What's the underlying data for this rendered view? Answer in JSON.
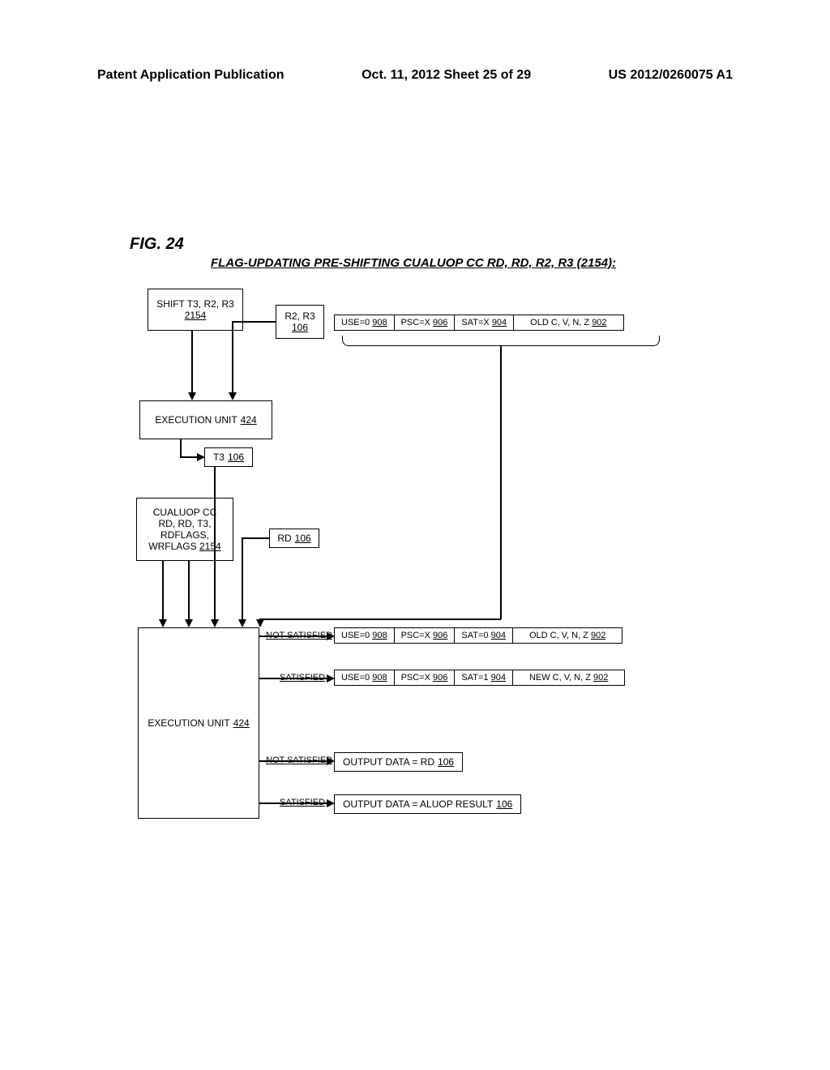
{
  "header": {
    "left": "Patent Application Publication",
    "center": "Oct. 11, 2012  Sheet 25 of 29",
    "right": "US 2012/0260075 A1"
  },
  "figure": {
    "label": "FIG. 24",
    "title": "FLAG-UPDATING PRE-SHIFTING CUALUOP CC RD, RD, R2, R3 (2154):"
  },
  "blocks": {
    "shift": {
      "line1": "SHIFT T3, R2, R3",
      "ref": "2154"
    },
    "r2r3": {
      "label": "R2, R3",
      "ref": "106"
    },
    "row1": {
      "use": "USE=0",
      "use_ref": "908",
      "psc": "PSC=X",
      "psc_ref": "906",
      "sat": "SAT=X",
      "sat_ref": "904",
      "flags": "OLD C, V, N, Z",
      "flags_ref": "902"
    },
    "execunit1": {
      "label": "EXECUTION UNIT",
      "ref": "424"
    },
    "t3": {
      "label": "T3",
      "ref": "106"
    },
    "cualuop": {
      "l1": "CUALUOP CC",
      "l2": "RD, RD, T3,",
      "l3": "RDFLAGS,",
      "l4": "WRFLAGS",
      "ref": "2154"
    },
    "rd": {
      "label": "RD",
      "ref": "106"
    },
    "execunit2": {
      "label": "EXECUTION UNIT",
      "ref": "424"
    },
    "row_notsat": {
      "use": "USE=0",
      "use_ref": "908",
      "psc": "PSC=X",
      "psc_ref": "906",
      "sat": "SAT=0",
      "sat_ref": "904",
      "flags": "OLD C, V, N, Z",
      "flags_ref": "902"
    },
    "row_sat": {
      "use": "USE=0",
      "use_ref": "908",
      "psc": "PSC=X",
      "psc_ref": "906",
      "sat": "SAT=1",
      "sat_ref": "904",
      "flags": "NEW C, V, N, Z",
      "flags_ref": "902"
    },
    "out_notsat": {
      "label": "OUTPUT DATA = RD",
      "ref": "106"
    },
    "out_sat": {
      "label": "OUTPUT DATA = ALUOP RESULT",
      "ref": "106"
    },
    "branch_notsat": "NOT SATISFIED",
    "branch_sat": "SATISFIED"
  }
}
